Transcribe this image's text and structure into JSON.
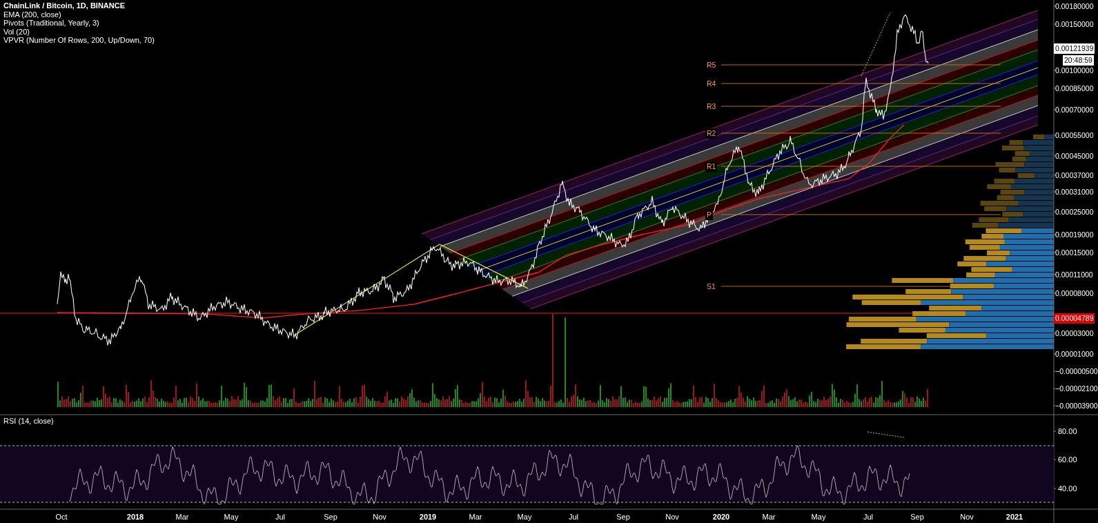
{
  "legend": {
    "symbol": "ChainLink / Bitcoin, 1D, BINANCE",
    "indicators": [
      "EMA (200, close)",
      "Pivots (Traditional, Yearly, 3)",
      "Vol (20)",
      "VPVR (Number Of Rows, 200, Up/Down, 70)"
    ]
  },
  "price_axis": {
    "ticks": [
      "0.00180000",
      "0.00150000",
      "0.00100000",
      "0.00085000",
      "0.00070000",
      "0.00055000",
      "0.00045000",
      "0.00037000",
      "0.00031000",
      "0.00025000",
      "0.00019000",
      "0.00015000",
      "0.00011000",
      "0.00008000",
      "0.00003000",
      "0.00001000",
      "−0.00000500",
      "−0.00002100",
      "−0.00003900"
    ],
    "last_price": "0.00121939",
    "countdown": "20:48:59",
    "marker_price": "0.00004789"
  },
  "pivots": [
    "R5",
    "R4",
    "R3",
    "R2",
    "R1",
    "P",
    "S1"
  ],
  "rsi": {
    "legend": "RSI (14, close)",
    "ticks": [
      "80.00",
      "60.00",
      "40.00"
    ]
  },
  "time_axis": [
    "Oct",
    "2018",
    "Mar",
    "May",
    "Jul",
    "Sep",
    "Nov",
    "2019",
    "Mar",
    "May",
    "Jul",
    "Sep",
    "Nov",
    "2020",
    "Mar",
    "May",
    "Jul",
    "Sep",
    "Nov",
    "2021"
  ]
}
